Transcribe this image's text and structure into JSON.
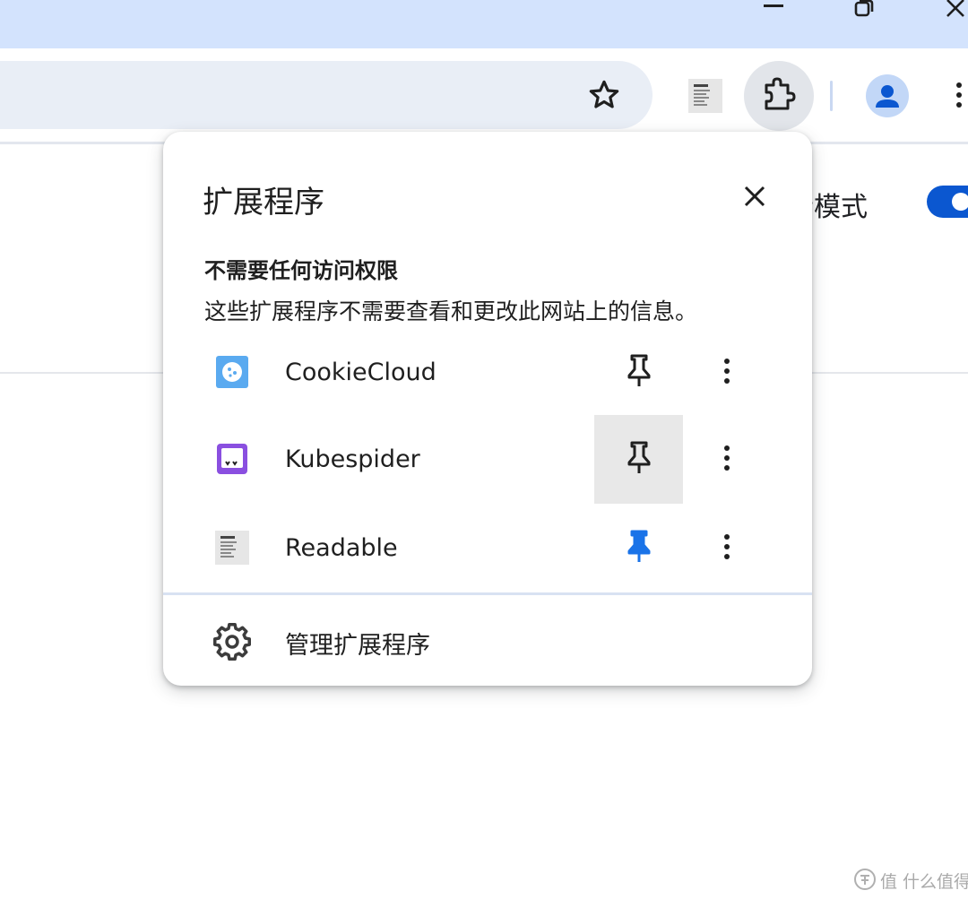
{
  "colors": {
    "titlebar": "#d3e3fd",
    "omnibox": "#e9eef6",
    "accent_blue": "#0b57d0",
    "pinned_blue": "#1a73e8"
  },
  "window_controls": {
    "minimize_icon": "minimize-icon",
    "restore_icon": "restore-icon",
    "close_icon": "close-icon"
  },
  "toolbar": {
    "bookmark_icon": "star-icon",
    "pinned_extension": "Readable",
    "extensions_icon": "puzzle-icon",
    "profile_icon": "person-icon",
    "menu_icon": "more-vertical-icon"
  },
  "page": {
    "mode_label": "者模式",
    "mode_toggle_on": true
  },
  "extensions_popup": {
    "title": "扩展程序",
    "section_heading": "不需要任何访问权限",
    "section_description": "这些扩展程序不需要查看和更改此网站上的信息。",
    "extensions": [
      {
        "name": "CookieCloud",
        "pinned": false,
        "icon": "cookiecloud-icon"
      },
      {
        "name": "Kubespider",
        "pinned": false,
        "icon": "kubespider-icon"
      },
      {
        "name": "Readable",
        "pinned": true,
        "icon": "readable-icon"
      }
    ],
    "manage_label": "管理扩展程序"
  },
  "watermark": {
    "text": "值 什么值得买"
  }
}
